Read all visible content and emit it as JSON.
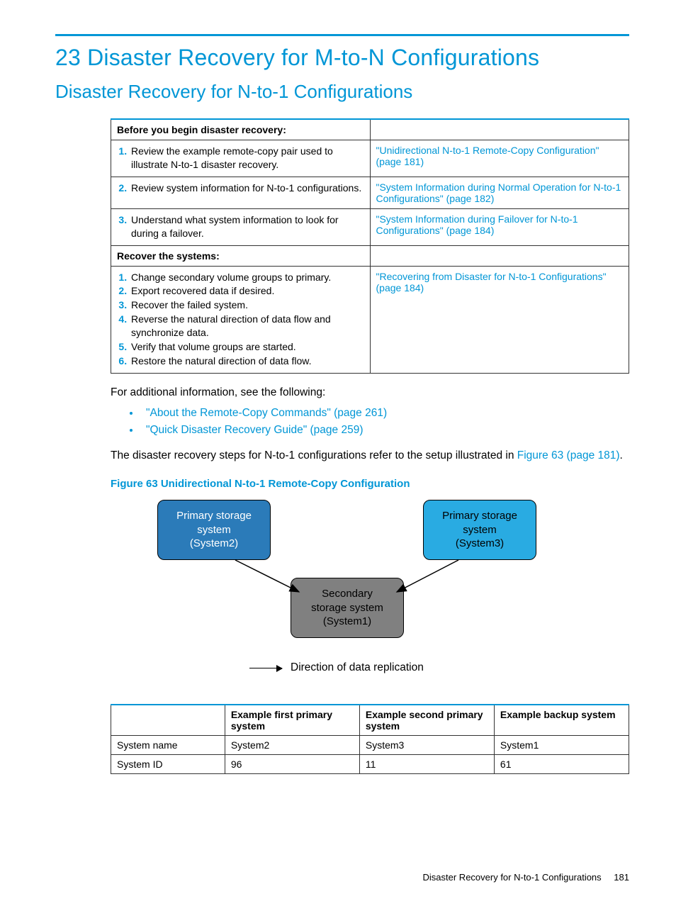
{
  "chapter": {
    "title": "23 Disaster Recovery for M-to-N Configurations"
  },
  "section": {
    "title": "Disaster Recovery for N-to-1 Configurations"
  },
  "table1": {
    "header1": "Before you begin disaster recovery:",
    "row1": {
      "step": "Review the example remote-copy pair used to illustrate N-to-1 disaster recovery.",
      "ref": "\"Unidirectional N-to-1 Remote-Copy Configuration\" (page 181)"
    },
    "row2": {
      "step": "Review system information for N-to-1 configurations.",
      "ref": "\"System Information during Normal Operation for N-to-1 Configurations\" (page 182)"
    },
    "row3": {
      "step": "Understand what system information to look for during a failover.",
      "ref": "\"System Information during Failover for N-to-1 Configurations\" (page 184)"
    },
    "header2": "Recover the systems:",
    "recover": {
      "s1": "Change secondary volume groups to primary.",
      "s2": "Export recovered data if desired.",
      "s3": "Recover the failed system.",
      "s4": "Reverse the natural direction of data flow and synchronize data.",
      "s5": "Verify that volume groups are started.",
      "s6": "Restore the natural direction of data flow.",
      "ref": "\"Recovering from Disaster for N-to-1 Configurations\" (page 184)"
    }
  },
  "para1": "For additional information, see the following:",
  "bullets": {
    "b1": "\"About the Remote-Copy Commands\" (page 261)",
    "b2": "\"Quick Disaster Recovery Guide\" (page 259)"
  },
  "para2_pre": "The disaster recovery steps for N-to-1 configurations refer to the setup illustrated in ",
  "para2_link": "Figure 63 (page 181)",
  "para2_post": ".",
  "figure": {
    "caption": "Figure 63 Unidirectional N-to-1 Remote-Copy Configuration",
    "node_left": "Primary storage system (System2)",
    "node_right": "Primary storage system (System3)",
    "node_center": "Secondary storage system (System1)",
    "legend": "Direction of data replication"
  },
  "table2": {
    "h1": "",
    "h2": "Example first primary system",
    "h3": "Example second primary system",
    "h4": "Example backup system",
    "r1": {
      "c1": "System name",
      "c2": "System2",
      "c3": "System3",
      "c4": "System1"
    },
    "r2": {
      "c1": "System ID",
      "c2": "96",
      "c3": "11",
      "c4": "61"
    }
  },
  "footer": {
    "text": "Disaster Recovery for N-to-1 Configurations",
    "page": "181"
  }
}
